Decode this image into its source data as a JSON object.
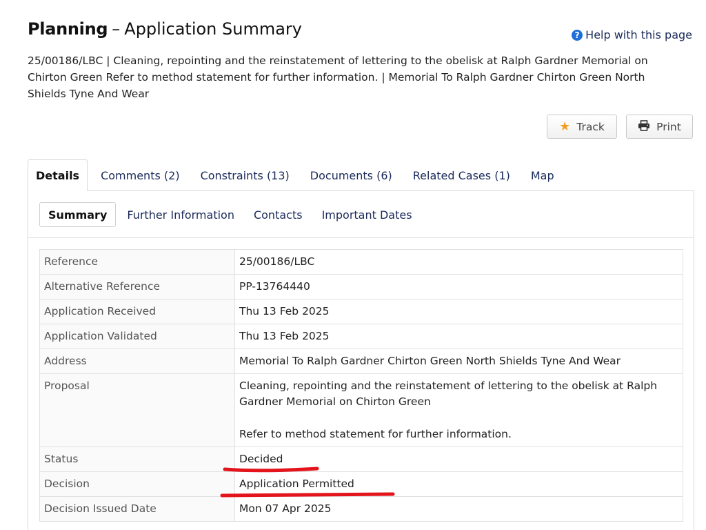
{
  "page": {
    "title_bold": "Planning",
    "title_separator": "–",
    "title_rest": "Application Summary",
    "help_link": "Help with this page",
    "description": "25/00186/LBC | Cleaning, repointing and the reinstatement of lettering to the obelisk at Ralph Gardner Memorial on Chirton Green Refer to method statement for further information. | Memorial To Ralph Gardner Chirton Green North Shields Tyne And Wear"
  },
  "actions": {
    "track": "Track",
    "print": "Print"
  },
  "tabs": [
    {
      "label": "Details"
    },
    {
      "label": "Comments (2)"
    },
    {
      "label": "Constraints (13)"
    },
    {
      "label": "Documents (6)"
    },
    {
      "label": "Related Cases (1)"
    },
    {
      "label": "Map"
    }
  ],
  "subtabs": [
    {
      "label": "Summary"
    },
    {
      "label": "Further Information"
    },
    {
      "label": "Contacts"
    },
    {
      "label": "Important Dates"
    }
  ],
  "details": {
    "reference": {
      "label": "Reference",
      "value": "25/00186/LBC"
    },
    "alt_reference": {
      "label": "Alternative Reference",
      "value": "PP-13764440"
    },
    "received": {
      "label": "Application Received",
      "value": "Thu 13 Feb 2025"
    },
    "validated": {
      "label": "Application Validated",
      "value": "Thu 13 Feb 2025"
    },
    "address": {
      "label": "Address",
      "value": "Memorial To Ralph Gardner Chirton Green North Shields Tyne And Wear"
    },
    "proposal": {
      "label": "Proposal",
      "value_line1": "Cleaning, repointing and the reinstatement of lettering to the obelisk at Ralph Gardner Memorial on Chirton Green",
      "value_line2": "Refer to method statement for further information."
    },
    "status": {
      "label": "Status",
      "value": "Decided"
    },
    "decision": {
      "label": "Decision",
      "value": "Application Permitted"
    },
    "decision_issued": {
      "label": "Decision Issued Date",
      "value": "Mon 07 Apr 2025"
    }
  },
  "colors": {
    "link": "#1a2a5a",
    "help_icon": "#1e6fd9",
    "star": "#f0a020",
    "annotation": "#e3141b"
  },
  "icons": {
    "help": "help-circle-icon",
    "track": "star-icon",
    "print": "printer-icon"
  }
}
